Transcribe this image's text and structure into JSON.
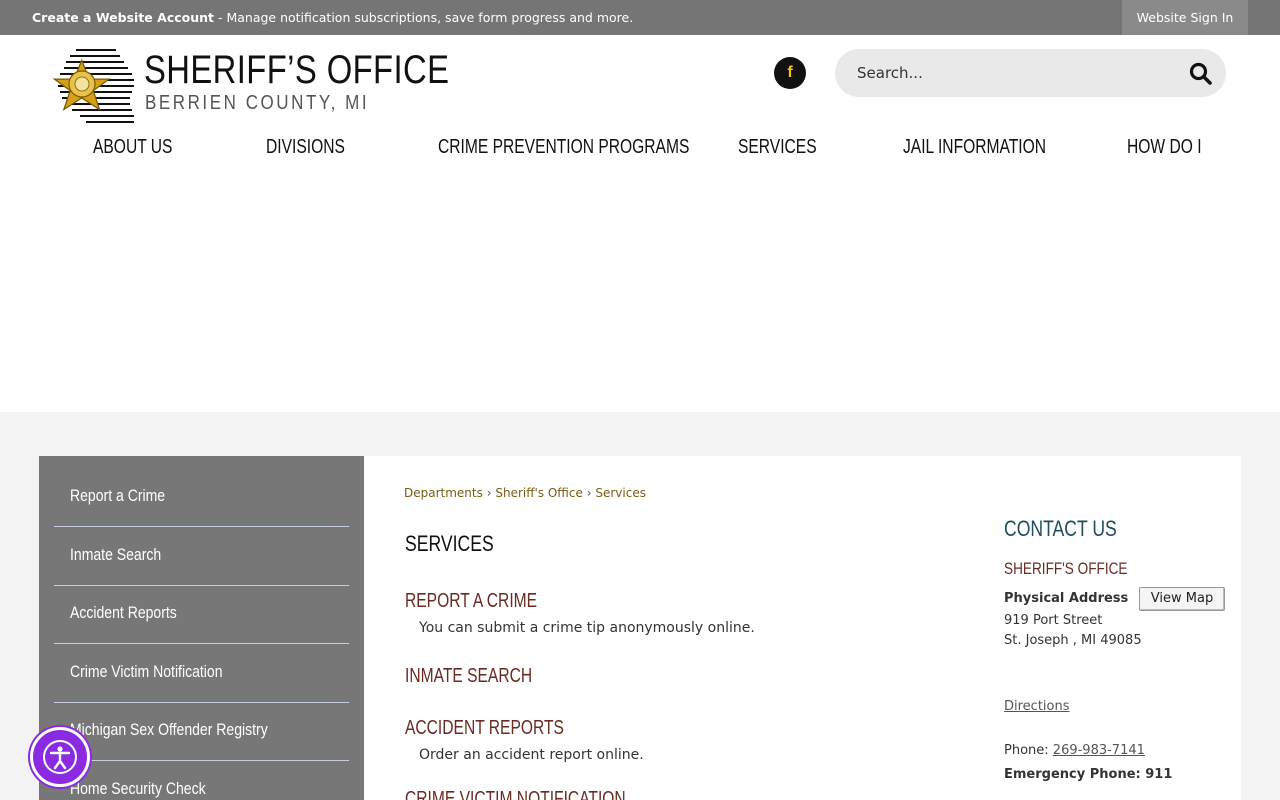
{
  "topbar": {
    "create_account": "Create a Website Account",
    "create_account_desc": " - Manage notification subscriptions, save form progress and more.",
    "sign_in": "Website Sign In"
  },
  "logo": {
    "title": "SHERIFF’S OFFICE",
    "subtitle": "BERRIEN COUNTY, MI",
    "badge_text": "BERRIEN COUNTY"
  },
  "header": {
    "facebook_icon": "facebook-icon",
    "search_placeholder": "Search...",
    "search_icon": "search-icon"
  },
  "nav": {
    "items": [
      "ABOUT US",
      "DIVISIONS",
      "CRIME PREVENTION PROGRAMS",
      "SERVICES",
      "JAIL INFORMATION",
      "HOW DO I"
    ]
  },
  "sidebar": {
    "items": [
      "Report a Crime",
      "Inmate Search",
      "Accident Reports",
      "Crime Victim Notification",
      "Michigan Sex Offender Registry",
      "Home Security Check"
    ]
  },
  "breadcrumb": {
    "items": [
      "Departments",
      "Sheriff's Office",
      "Services"
    ],
    "separator": "›"
  },
  "main": {
    "title": "SERVICES",
    "services": [
      {
        "title": "REPORT A CRIME",
        "desc": "You can submit a crime tip anonymously online."
      },
      {
        "title": "INMATE SEARCH",
        "desc": ""
      },
      {
        "title": "ACCIDENT REPORTS",
        "desc": "Order an accident report online."
      },
      {
        "title": "CRIME VICTIM NOTIFICATION",
        "desc": ""
      }
    ]
  },
  "contact": {
    "title": "CONTACT US",
    "org": "SHERIFF'S OFFICE",
    "address_label": "Physical Address",
    "view_map": "View Map",
    "address_line1": "919 Port Street",
    "address_line2": "St. Joseph , MI 49085",
    "directions": "Directions",
    "phone_label": "Phone: ",
    "phone": "269-983-7141",
    "emergency": "Emergency Phone: 911"
  },
  "accessibility": {
    "icon": "accessibility-icon"
  },
  "colors": {
    "topbar": "#757575",
    "sidebar": "#777777",
    "accent_red": "#6b2a22",
    "accent_teal": "#1f4d5c",
    "badge_gold": "#d4a017",
    "a11y_purple": "#8a2be2"
  }
}
